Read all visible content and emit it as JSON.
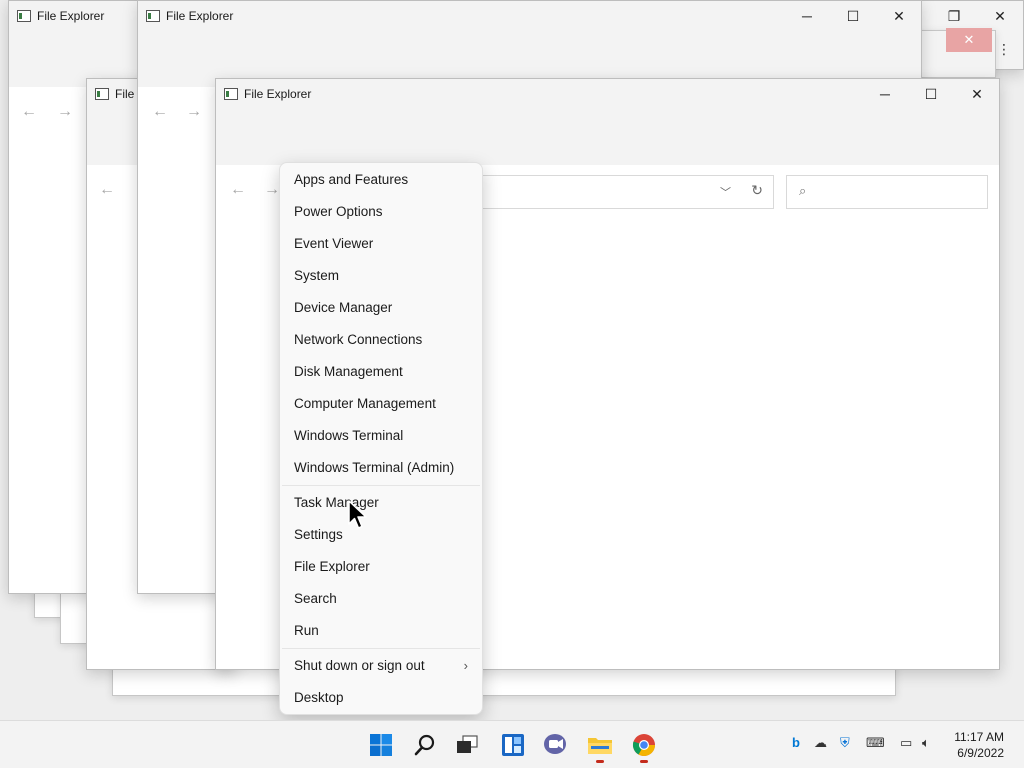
{
  "windows": {
    "title": "File Explorer",
    "truncated_title": "File E"
  },
  "context_menu": {
    "group1": [
      "Apps and Features",
      "Power Options",
      "Event Viewer",
      "System",
      "Device Manager",
      "Network Connections",
      "Disk Management",
      "Computer Management",
      "Windows Terminal",
      "Windows Terminal (Admin)"
    ],
    "group2": [
      "Task Manager",
      "Settings",
      "File Explorer",
      "Search",
      "Run"
    ],
    "group3": [
      "Shut down or sign out",
      "Desktop"
    ]
  },
  "taskbar": {
    "icons": [
      "start-icon",
      "search-icon",
      "task-view-icon",
      "widgets-icon",
      "chat-icon",
      "file-explorer-icon",
      "chrome-icon"
    ],
    "time": "11:17 AM",
    "date": "6/9/2022"
  },
  "colors": {
    "accent_blue": "#0067c0",
    "close_red": "#c42b1c",
    "folder_yellow": "#f4c534"
  }
}
